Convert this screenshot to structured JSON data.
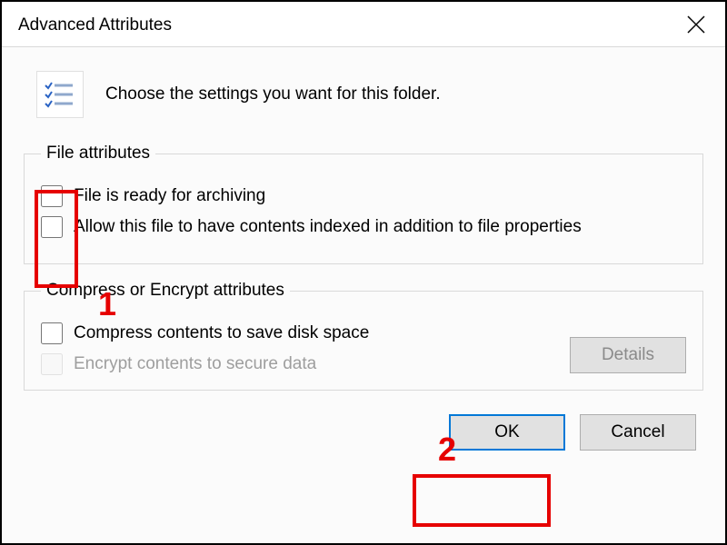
{
  "dialog": {
    "title": "Advanced Attributes",
    "intro": "Choose the settings you want for this folder."
  },
  "file_attributes": {
    "legend": "File attributes",
    "archive_label": "File is ready for archiving",
    "archive_checked": false,
    "index_label": "Allow this file to have contents indexed in addition to file properties",
    "index_checked": false
  },
  "compress_encrypt": {
    "legend": "Compress or Encrypt attributes",
    "compress_label": "Compress contents to save disk space",
    "compress_checked": false,
    "encrypt_label": "Encrypt contents to secure data",
    "encrypt_checked": false,
    "encrypt_enabled": false,
    "details_label": "Details",
    "details_enabled": false
  },
  "buttons": {
    "ok": "OK",
    "cancel": "Cancel"
  },
  "annotations": {
    "label1": "1",
    "label2": "2"
  }
}
